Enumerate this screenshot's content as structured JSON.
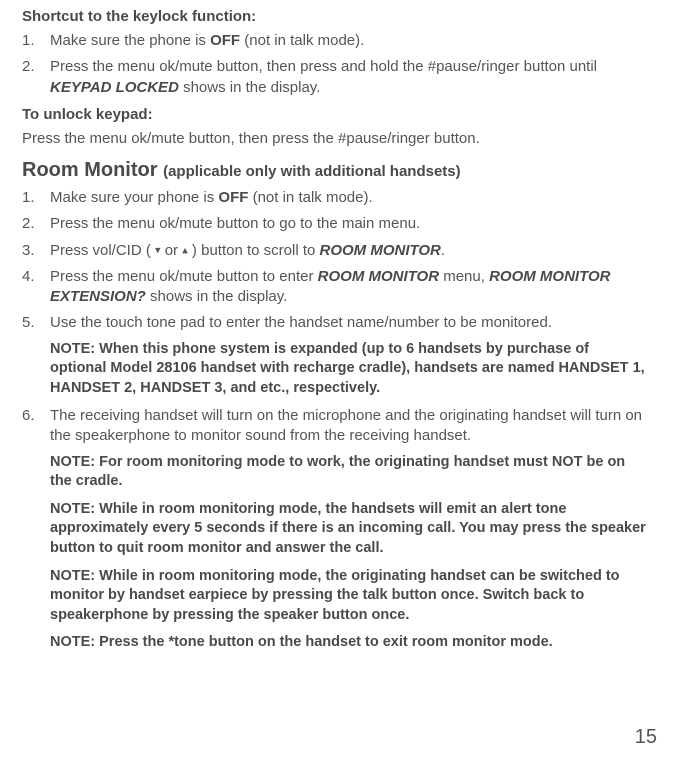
{
  "heading1": "Shortcut to the keylock function:",
  "list1": {
    "item1_pre": "Make sure the phone is ",
    "item1_bold": "OFF",
    "item1_post": " (not in talk mode).",
    "item2_pre": "Press the menu ok/mute button, then press and hold the #pause/ringer button until ",
    "item2_bold": "KEYPAD LOCKED",
    "item2_post": " shows in the display."
  },
  "heading2": "To unlock keypad:",
  "body1": "Press the menu ok/mute button, then press the #pause/ringer button.",
  "section_title_main": "Room Monitor ",
  "section_title_sub": "(applicable only with additional handsets)",
  "list2": {
    "item1_pre": "Make sure your phone is ",
    "item1_bold": "OFF",
    "item1_post": " (not in talk mode).",
    "item2": "Press the menu ok/mute button to go to the main menu.",
    "item3_pre": "Press vol/CID ( ",
    "item3_down": "▾",
    "item3_mid": " or ",
    "item3_up": "▴",
    "item3_mid2": " ) button to scroll to ",
    "item3_bold": "ROOM MONITOR",
    "item3_post": ".",
    "item4_pre": "Press the menu ok/mute button to enter ",
    "item4_bold1": "ROOM MONITOR",
    "item4_mid": " menu, ",
    "item4_bold2": "ROOM MONITOR EXTENSION?",
    "item4_post": " shows in the display.",
    "item5": "Use the touch tone pad to enter the handset name/number to be monitored.",
    "item6": "The receiving handset will turn on the microphone and the originating handset will turn on the speakerphone to monitor sound from the receiving handset."
  },
  "note1": "NOTE: When this phone system is expanded (up to 6 handsets by purchase of optional Model 28106 handset with recharge cradle), handsets are named HANDSET 1, HANDSET 2, HANDSET 3, and etc., respectively.",
  "note2": "NOTE: For room monitoring mode to work, the originating handset must NOT be on the cradle.",
  "note3": "NOTE: While in room monitoring mode, the handsets will emit an alert tone approximately every 5 seconds if there is an incoming call. You may press the speaker button to quit room monitor and answer the call.",
  "note4": "NOTE: While in room monitoring mode, the originating handset can be switched to monitor by handset earpiece by pressing the talk button once. Switch back to speakerphone by pressing the speaker button once.",
  "note5": "NOTE: Press the *tone button on the handset to exit room monitor mode.",
  "page_number": "15"
}
